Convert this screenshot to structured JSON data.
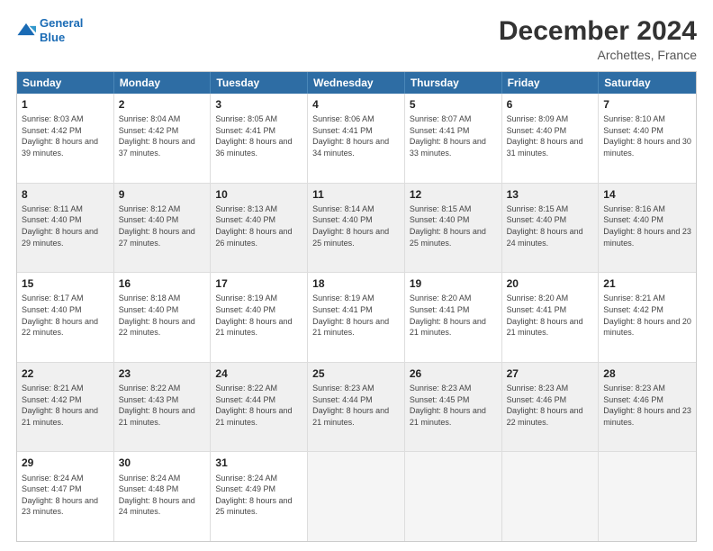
{
  "logo": {
    "line1": "General",
    "line2": "Blue"
  },
  "title": "December 2024",
  "subtitle": "Archettes, France",
  "days": [
    "Sunday",
    "Monday",
    "Tuesday",
    "Wednesday",
    "Thursday",
    "Friday",
    "Saturday"
  ],
  "rows": [
    [
      {
        "num": "1",
        "sunrise": "8:03 AM",
        "sunset": "4:42 PM",
        "daylight": "8 hours and 39 minutes."
      },
      {
        "num": "2",
        "sunrise": "8:04 AM",
        "sunset": "4:42 PM",
        "daylight": "8 hours and 37 minutes."
      },
      {
        "num": "3",
        "sunrise": "8:05 AM",
        "sunset": "4:41 PM",
        "daylight": "8 hours and 36 minutes."
      },
      {
        "num": "4",
        "sunrise": "8:06 AM",
        "sunset": "4:41 PM",
        "daylight": "8 hours and 34 minutes."
      },
      {
        "num": "5",
        "sunrise": "8:07 AM",
        "sunset": "4:41 PM",
        "daylight": "8 hours and 33 minutes."
      },
      {
        "num": "6",
        "sunrise": "8:09 AM",
        "sunset": "4:40 PM",
        "daylight": "8 hours and 31 minutes."
      },
      {
        "num": "7",
        "sunrise": "8:10 AM",
        "sunset": "4:40 PM",
        "daylight": "8 hours and 30 minutes."
      }
    ],
    [
      {
        "num": "8",
        "sunrise": "8:11 AM",
        "sunset": "4:40 PM",
        "daylight": "8 hours and 29 minutes."
      },
      {
        "num": "9",
        "sunrise": "8:12 AM",
        "sunset": "4:40 PM",
        "daylight": "8 hours and 27 minutes."
      },
      {
        "num": "10",
        "sunrise": "8:13 AM",
        "sunset": "4:40 PM",
        "daylight": "8 hours and 26 minutes."
      },
      {
        "num": "11",
        "sunrise": "8:14 AM",
        "sunset": "4:40 PM",
        "daylight": "8 hours and 25 minutes."
      },
      {
        "num": "12",
        "sunrise": "8:15 AM",
        "sunset": "4:40 PM",
        "daylight": "8 hours and 25 minutes."
      },
      {
        "num": "13",
        "sunrise": "8:15 AM",
        "sunset": "4:40 PM",
        "daylight": "8 hours and 24 minutes."
      },
      {
        "num": "14",
        "sunrise": "8:16 AM",
        "sunset": "4:40 PM",
        "daylight": "8 hours and 23 minutes."
      }
    ],
    [
      {
        "num": "15",
        "sunrise": "8:17 AM",
        "sunset": "4:40 PM",
        "daylight": "8 hours and 22 minutes."
      },
      {
        "num": "16",
        "sunrise": "8:18 AM",
        "sunset": "4:40 PM",
        "daylight": "8 hours and 22 minutes."
      },
      {
        "num": "17",
        "sunrise": "8:19 AM",
        "sunset": "4:40 PM",
        "daylight": "8 hours and 21 minutes."
      },
      {
        "num": "18",
        "sunrise": "8:19 AM",
        "sunset": "4:41 PM",
        "daylight": "8 hours and 21 minutes."
      },
      {
        "num": "19",
        "sunrise": "8:20 AM",
        "sunset": "4:41 PM",
        "daylight": "8 hours and 21 minutes."
      },
      {
        "num": "20",
        "sunrise": "8:20 AM",
        "sunset": "4:41 PM",
        "daylight": "8 hours and 21 minutes."
      },
      {
        "num": "21",
        "sunrise": "8:21 AM",
        "sunset": "4:42 PM",
        "daylight": "8 hours and 20 minutes."
      }
    ],
    [
      {
        "num": "22",
        "sunrise": "8:21 AM",
        "sunset": "4:42 PM",
        "daylight": "8 hours and 21 minutes."
      },
      {
        "num": "23",
        "sunrise": "8:22 AM",
        "sunset": "4:43 PM",
        "daylight": "8 hours and 21 minutes."
      },
      {
        "num": "24",
        "sunrise": "8:22 AM",
        "sunset": "4:44 PM",
        "daylight": "8 hours and 21 minutes."
      },
      {
        "num": "25",
        "sunrise": "8:23 AM",
        "sunset": "4:44 PM",
        "daylight": "8 hours and 21 minutes."
      },
      {
        "num": "26",
        "sunrise": "8:23 AM",
        "sunset": "4:45 PM",
        "daylight": "8 hours and 21 minutes."
      },
      {
        "num": "27",
        "sunrise": "8:23 AM",
        "sunset": "4:46 PM",
        "daylight": "8 hours and 22 minutes."
      },
      {
        "num": "28",
        "sunrise": "8:23 AM",
        "sunset": "4:46 PM",
        "daylight": "8 hours and 23 minutes."
      }
    ],
    [
      {
        "num": "29",
        "sunrise": "8:24 AM",
        "sunset": "4:47 PM",
        "daylight": "8 hours and 23 minutes."
      },
      {
        "num": "30",
        "sunrise": "8:24 AM",
        "sunset": "4:48 PM",
        "daylight": "8 hours and 24 minutes."
      },
      {
        "num": "31",
        "sunrise": "8:24 AM",
        "sunset": "4:49 PM",
        "daylight": "8 hours and 25 minutes."
      },
      null,
      null,
      null,
      null
    ]
  ]
}
